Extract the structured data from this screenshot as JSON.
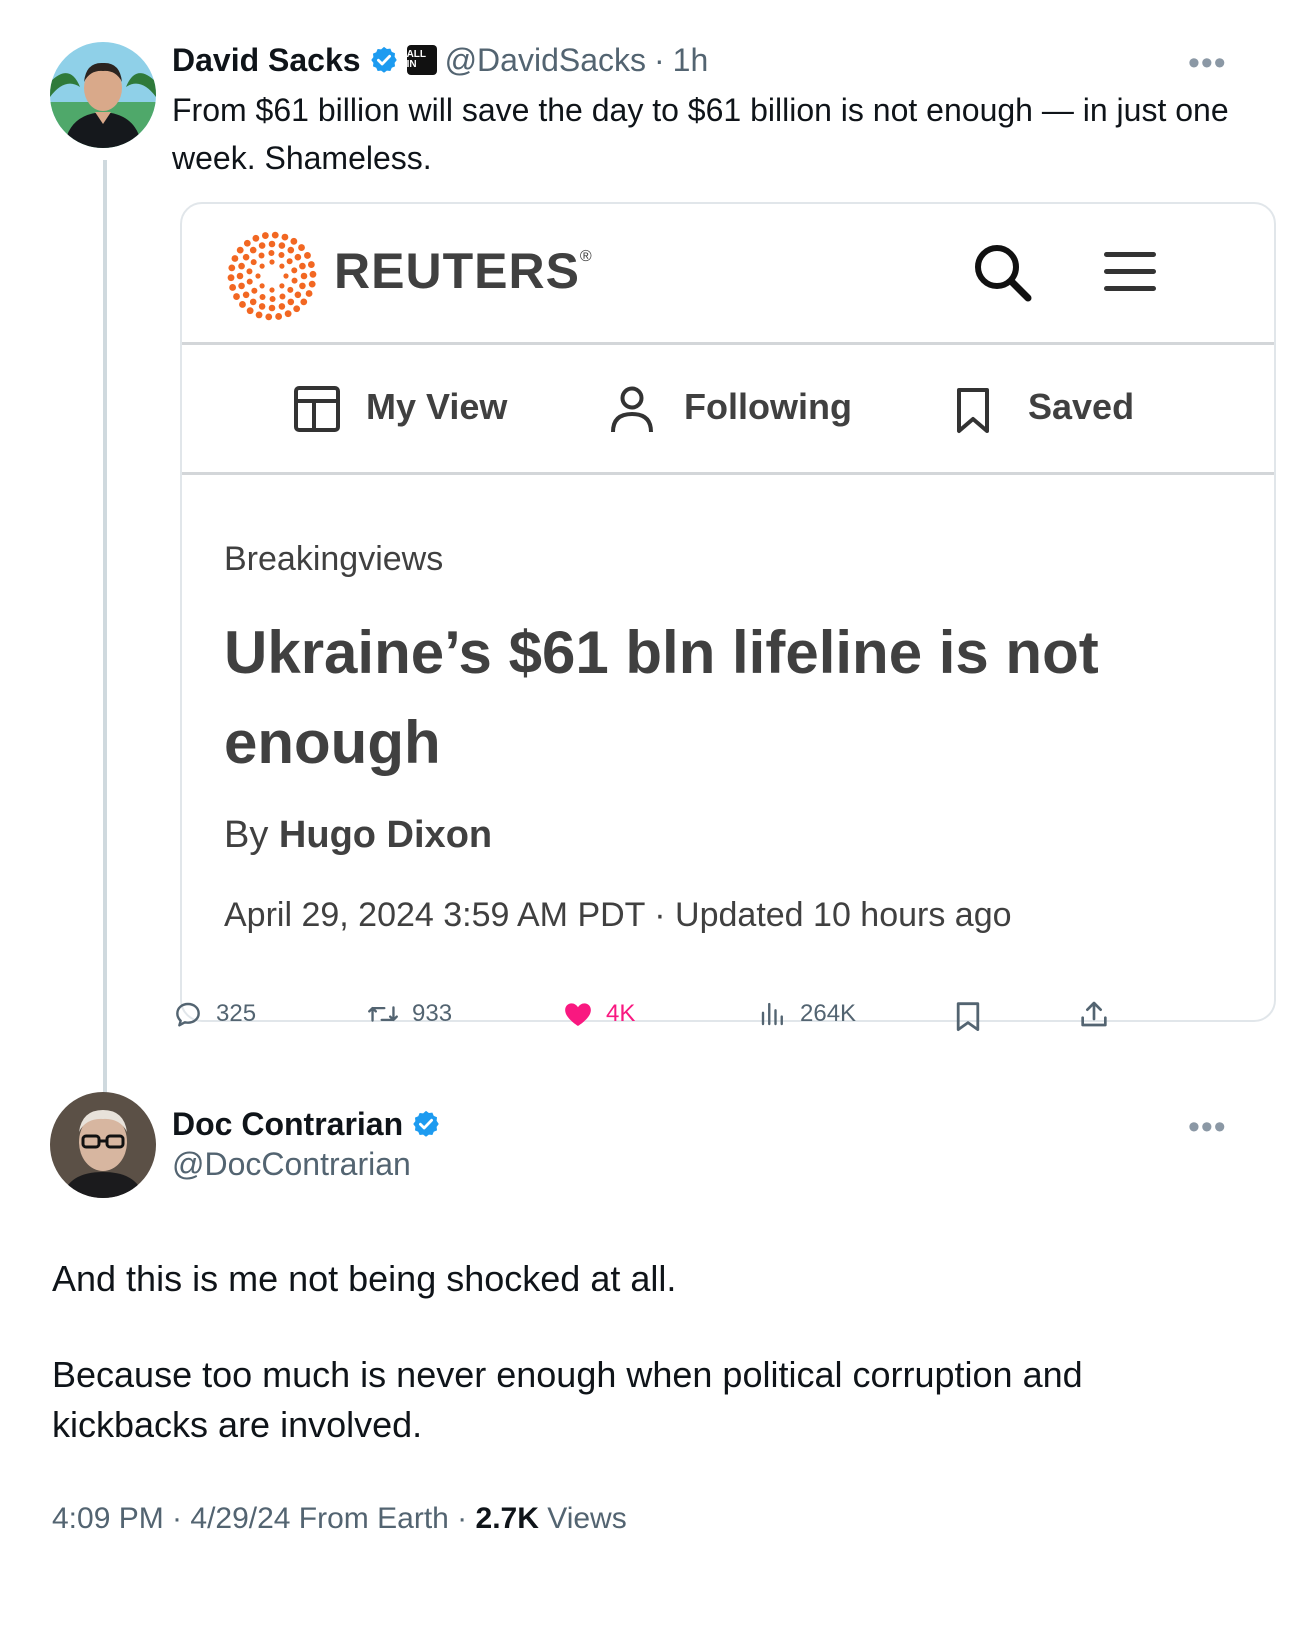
{
  "tweet1": {
    "author_name": "David Sacks",
    "handle": "@DavidSacks",
    "time": "1h",
    "separator": "·",
    "affiliate_badge": "ALL IN",
    "text": "From $61 billion will save the day to $61 billion is not enough — in just one week. Shameless.",
    "more_icon": "more-horizontal-icon",
    "stats": {
      "replies": "325",
      "reposts": "933",
      "likes": "4K",
      "views": "264K"
    },
    "like_color": "#f91880"
  },
  "card": {
    "brand": "REUTERS",
    "brand_mark": "®",
    "brand_color": "#f26722",
    "nav": {
      "my_view": "My View",
      "following": "Following",
      "saved": "Saved"
    },
    "kicker": "Breakingviews",
    "headline": "Ukraine’s $61 bln lifeline is not enough",
    "byline_prefix": "By",
    "author": "Hugo Dixon",
    "dateline": "April 29, 2024 3:59 AM PDT · Updated 10 hours ago"
  },
  "tweet2": {
    "author_name": "Doc Contrarian",
    "handle": "@DocContrarian",
    "paragraph1": "And this is me not being shocked at all.",
    "paragraph2": "Because too much is never enough when political corruption and kickbacks are involved.",
    "meta_prefix": "4:09 PM · 4/29/24 From Earth ·",
    "views_count": "2.7K",
    "views_label": "Views"
  },
  "colors": {
    "verified": "#1d9bf0",
    "secondary_text": "#536471",
    "thread_line": "#cfd9de"
  }
}
